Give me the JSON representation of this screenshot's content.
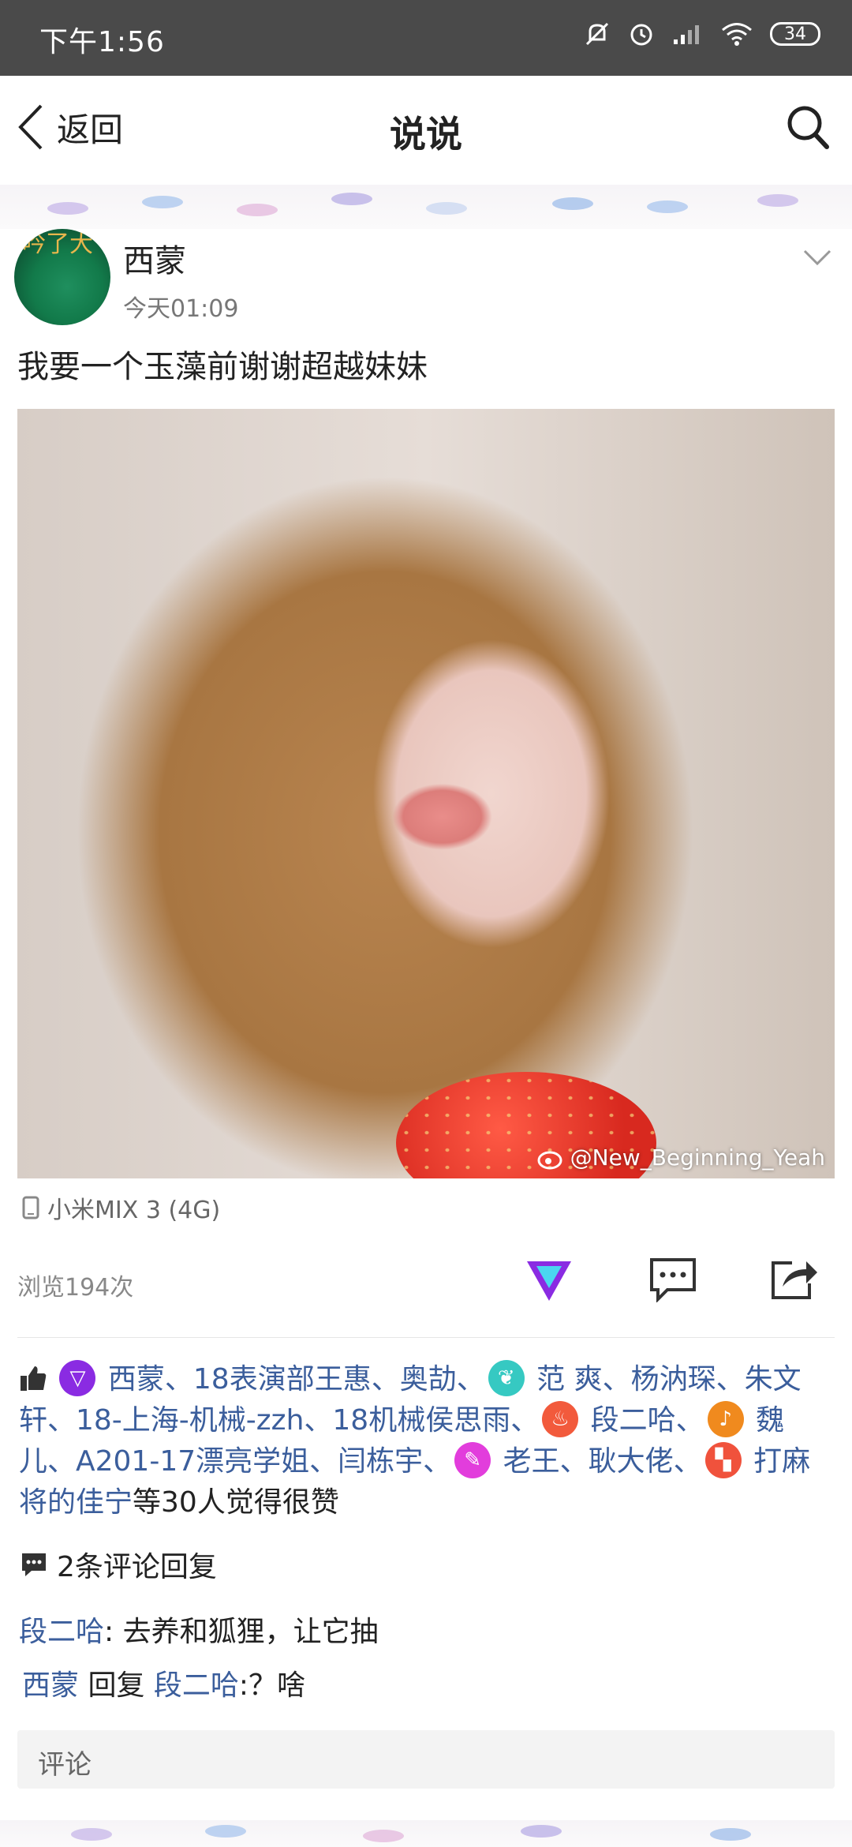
{
  "status_bar": {
    "time": "下午1:56",
    "battery": "34"
  },
  "header": {
    "back_label": "返回",
    "title": "说说"
  },
  "post": {
    "author": "西蒙",
    "time": "今天01:09",
    "text": "我要一个玉藻前谢谢超越妹妹",
    "avatar_text": "吟了大",
    "watermark": "@New_Beginning_Yeah",
    "device": "小米MIX 3 (4G)",
    "views": "浏览194次",
    "likes": {
      "seg1": "西蒙、18表演部王惠、奥劼、",
      "seg2": "范  爽、杨汭琛、朱文轩、18-上海-机械-zzh、18机械侯思雨、",
      "seg3": "段二哈、",
      "seg4": "魏儿、A201-17漂亮学姐、闫栋宇、",
      "seg5": "老王、耿大佬、",
      "seg6": "打麻将的佳宁",
      "suffix": "等30人觉得很赞"
    },
    "comment_count": "2条评论回复",
    "comments": [
      {
        "author": "段二哈",
        "text": ": 去养和狐狸，让它抽"
      },
      {
        "author": "西蒙",
        "reply_word": " 回复 ",
        "target": "段二哈",
        "text": ":？啥"
      }
    ],
    "comment_placeholder": "评论"
  },
  "icons": {
    "back": "chevron-left-icon",
    "search": "search-icon",
    "like": "thumbs-up-icon",
    "comment": "comment-icon",
    "share": "share-icon",
    "device": "phone-icon"
  },
  "colors": {
    "accent": "#8a2be2",
    "link": "#3b5e9c",
    "statusbar": "#4a4a4a"
  }
}
